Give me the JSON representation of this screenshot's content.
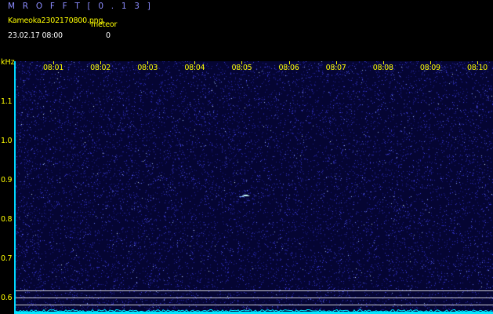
{
  "app": {
    "title": "M R O F F T   [ 0 . 1 3 ]"
  },
  "capture": {
    "filename": "Kameoka2302170800.png",
    "meteor_label": "meteor",
    "datetime": "23.02.17 08:00",
    "meteor_count": "0"
  },
  "spectrogram": {
    "time_ticks": [
      "08:01",
      "08:02",
      "08:03",
      "08:04",
      "08:05",
      "08:06",
      "08:07",
      "08:08",
      "08:09",
      "08:10"
    ],
    "freq_unit": "kHz",
    "freq_ticks": [
      "1.1",
      "1.0",
      "0.9",
      "0.8",
      "0.7",
      "0.6"
    ],
    "freq_range_khz": [
      0.575,
      1.2
    ],
    "time_range_min": [
      0.0,
      10.0
    ],
    "meteor_echo": {
      "time_min": 5.08,
      "freq_khz": 0.862
    },
    "colors": {
      "background": "#050533",
      "noise": "#3a3ad8",
      "echo": "#c8ffff",
      "axis": "#00d8ff",
      "tick_label": "#ffff00",
      "trace": "#00e6ff"
    }
  }
}
